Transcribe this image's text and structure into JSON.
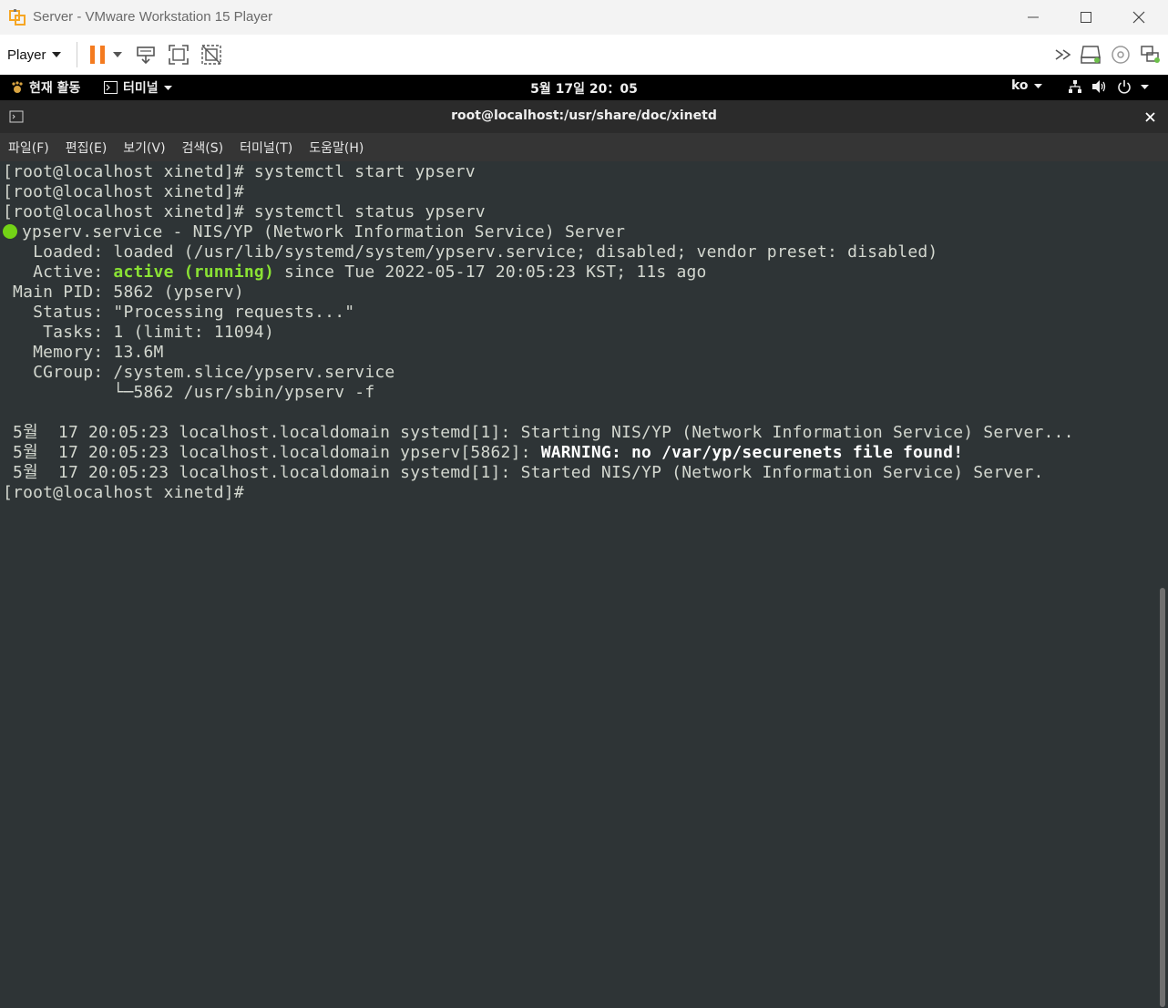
{
  "window": {
    "title": "Server - VMware Workstation 15 Player",
    "player_label": "Player"
  },
  "gnome": {
    "activities": "현재 활동",
    "app_menu": "터미널",
    "clock": "5월 17일  20：05",
    "lang": "ko"
  },
  "terminal": {
    "title": "root@localhost:/usr/share/doc/xinetd",
    "menu": [
      "파일(F)",
      "편집(E)",
      "보기(V)",
      "검색(S)",
      "터미널(T)",
      "도움말(H)"
    ],
    "lines": {
      "l1": "[root@localhost xinetd]# systemctl start ypserv",
      "l2": "[root@localhost xinetd]#",
      "l3": "[root@localhost xinetd]# systemctl status ypserv",
      "l4": "ypserv.service - NIS/YP (Network Information Service) Server",
      "l5": "   Loaded: loaded (/usr/lib/systemd/system/ypserv.service; disabled; vendor preset: disabled)",
      "l6_prefix": "   Active: ",
      "l6_status": "active (running)",
      "l6_suffix": " since Tue 2022-05-17 20:05:23 KST; 11s ago",
      "l7": " Main PID: 5862 (ypserv)",
      "l8": "   Status: \"Processing requests...\"",
      "l9": "    Tasks: 1 (limit: 11094)",
      "l10": "   Memory: 13.6M",
      "l11": "   CGroup: /system.slice/ypserv.service",
      "l12": "           └─5862 /usr/sbin/ypserv -f",
      "l14": " 5월  17 20:05:23 localhost.localdomain systemd[1]: Starting NIS/YP (Network Information Service) Server...",
      "l15_prefix": " 5월  17 20:05:23 localhost.localdomain ypserv[5862]: ",
      "l15_warning": "WARNING: no /var/yp/securenets file found!",
      "l16": " 5월  17 20:05:23 localhost.localdomain systemd[1]: Started NIS/YP (Network Information Service) Server.",
      "l17": "[root@localhost xinetd]#"
    }
  },
  "colors": {
    "status_green": "#8ae234",
    "terminal_bg": "#2e3436",
    "pause_orange": "#f47b20"
  }
}
